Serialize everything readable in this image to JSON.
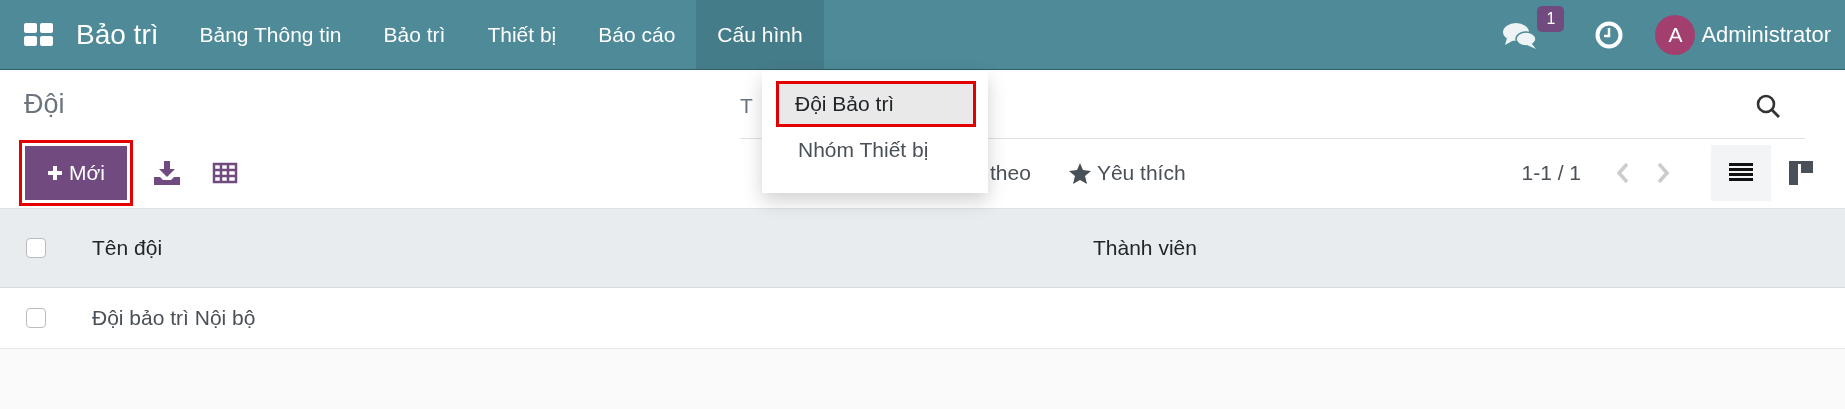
{
  "navbar": {
    "app_name": "Bảo trì",
    "menu": [
      {
        "label": "Bảng Thông tin",
        "selected": false
      },
      {
        "label": "Bảo trì",
        "selected": false
      },
      {
        "label": "Thiết bị",
        "selected": false
      },
      {
        "label": "Báo cáo",
        "selected": false
      },
      {
        "label": "Cấu hình",
        "selected": true
      }
    ],
    "messages_badge": "1",
    "user_initial": "A",
    "user_name": "Administrator"
  },
  "dropdown": {
    "items": [
      {
        "label": "Đội Bảo trì",
        "selected": true,
        "highlighted": true
      },
      {
        "label": "Nhóm Thiết bị",
        "selected": false,
        "highlighted": false
      }
    ]
  },
  "control_panel": {
    "title": "Đội",
    "search_placeholder": "T",
    "new_button": {
      "label": "Mới",
      "highlighted": true
    },
    "group_by": "theo",
    "favorites": "Yêu thích",
    "pager": "1-1 / 1",
    "views": [
      {
        "kind": "list",
        "selected": true
      },
      {
        "kind": "kanban",
        "selected": false
      }
    ]
  },
  "table": {
    "select_all_checked": false,
    "columns": [
      "Tên đội",
      "Thành viên"
    ],
    "rows": [
      {
        "name": "Đội bảo trì Nội bộ",
        "checked": false
      }
    ]
  }
}
